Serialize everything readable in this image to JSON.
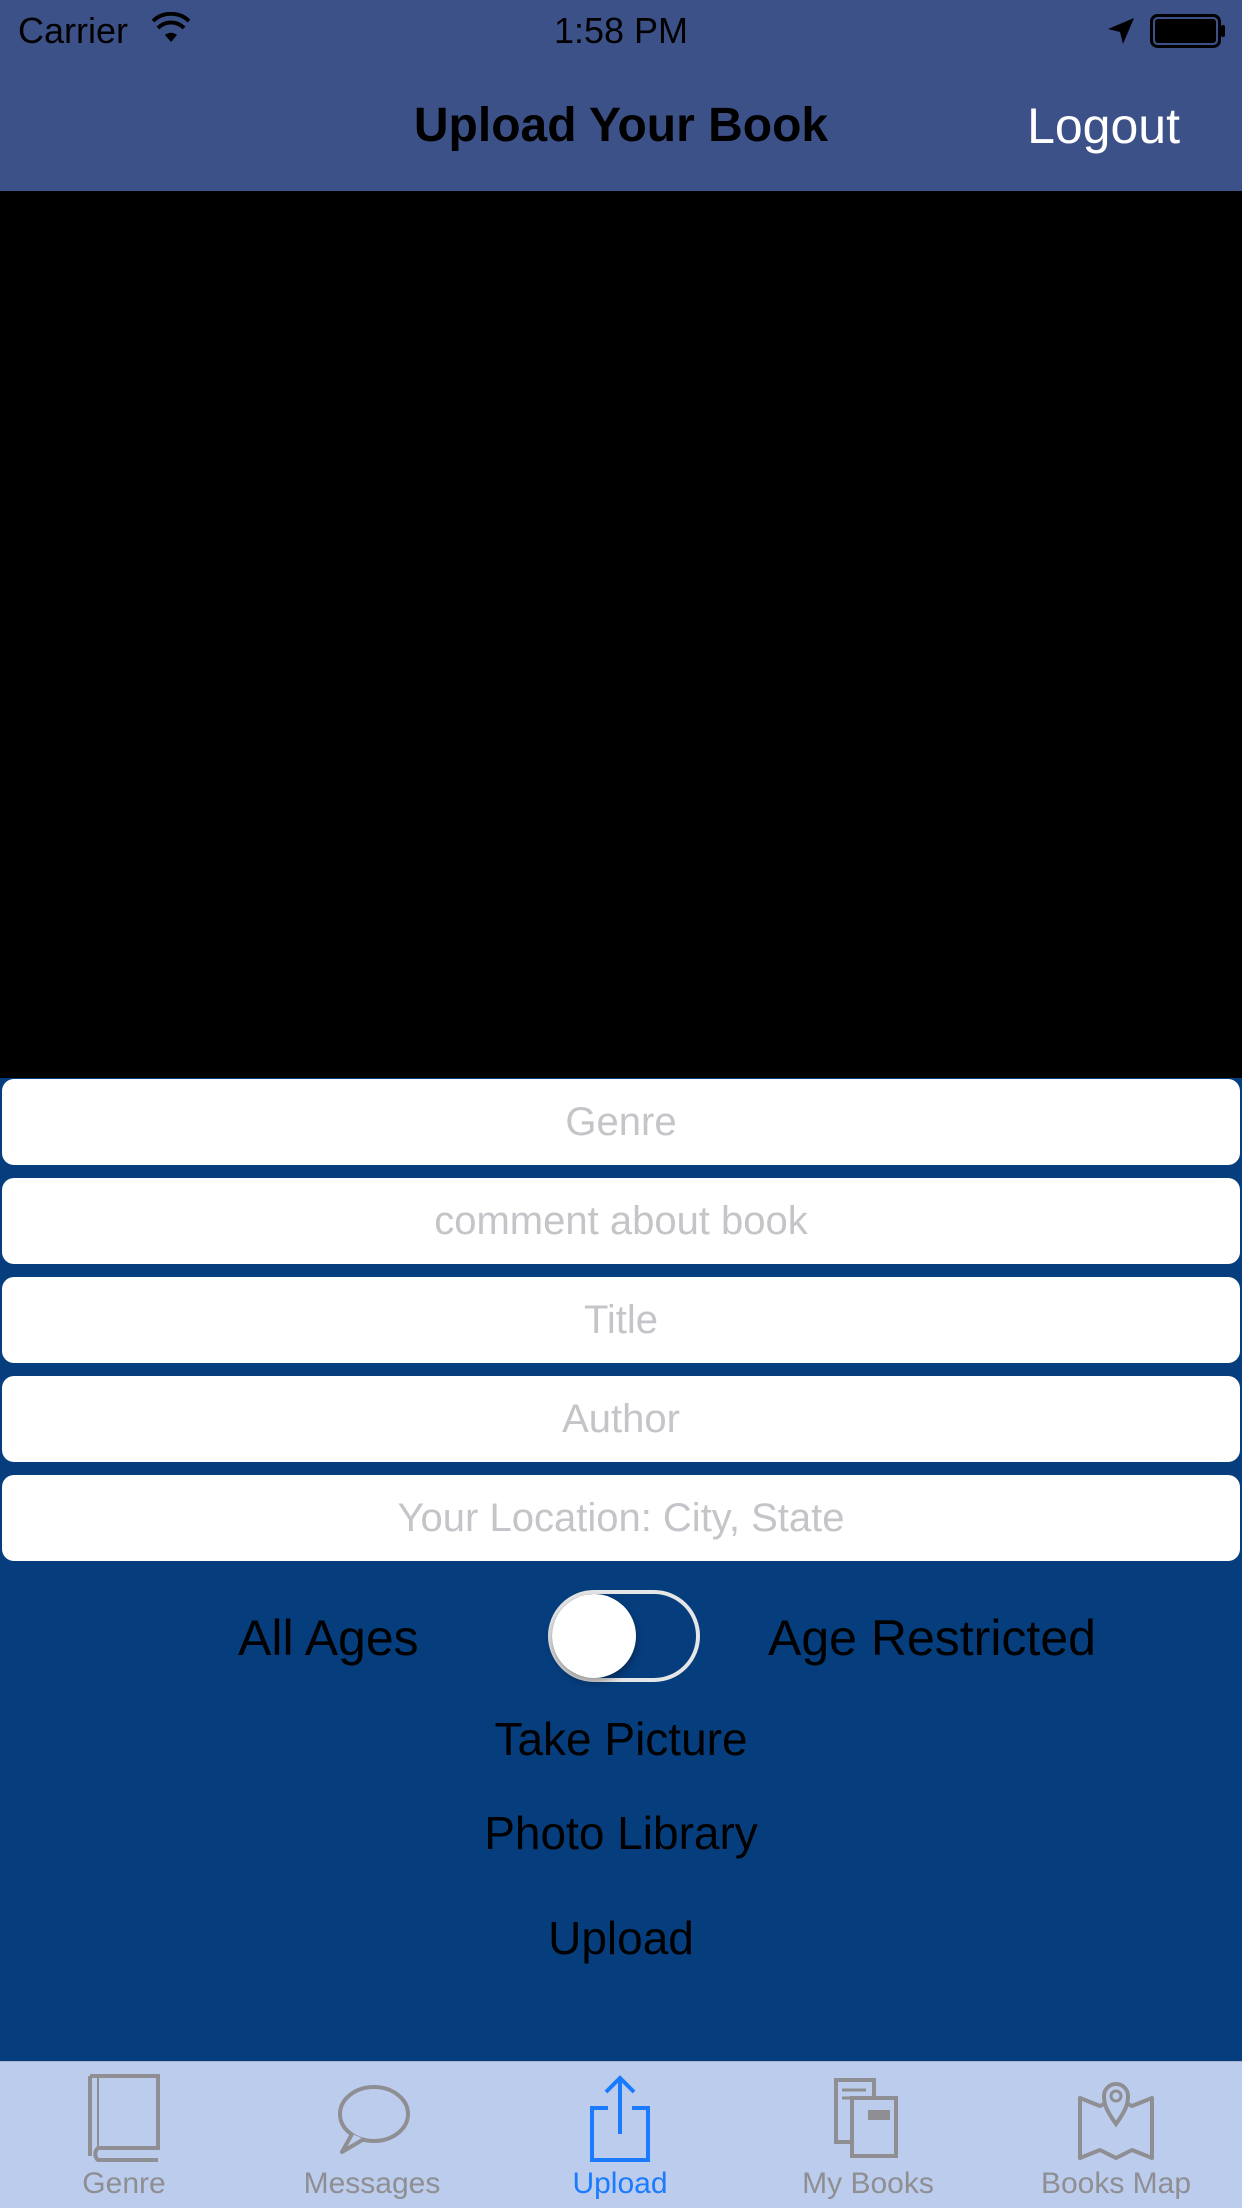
{
  "status_bar": {
    "carrier": "Carrier",
    "time": "1:58 PM"
  },
  "nav": {
    "title": "Upload Your Book",
    "logout_label": "Logout"
  },
  "form": {
    "genre_placeholder": "Genre",
    "comment_placeholder": "comment about book",
    "title_placeholder": "Title",
    "author_placeholder": "Author",
    "location_placeholder": "Your Location: City, State"
  },
  "age": {
    "left_label": "All Ages",
    "right_label": "Age Restricted",
    "restricted": false
  },
  "actions": {
    "take_picture": "Take Picture",
    "photo_library": "Photo Library",
    "upload": "Upload"
  },
  "tabbar": {
    "active_color": "#1a7bff",
    "inactive_color": "#8e8e93",
    "items": [
      {
        "label": "Genre",
        "icon": "book-icon"
      },
      {
        "label": "Messages",
        "icon": "speech-bubble-icon"
      },
      {
        "label": "Upload",
        "icon": "share-upload-icon"
      },
      {
        "label": "My Books",
        "icon": "books-icon"
      },
      {
        "label": "Books Map",
        "icon": "map-pin-icon"
      }
    ],
    "active_index": 2
  },
  "colors": {
    "nav_background": "#3d5189",
    "page_background": "#063d7d",
    "tabbar_background": "#bcccec"
  }
}
